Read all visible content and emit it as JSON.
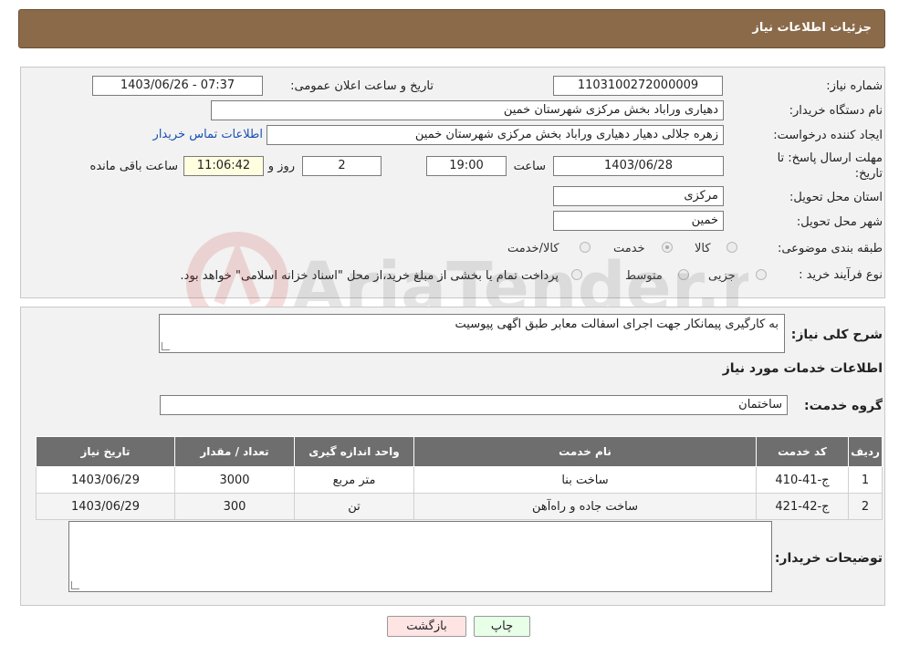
{
  "header": {
    "title": "جزئیات اطلاعات نیاز"
  },
  "labels": {
    "need_number": "شماره نیاز:",
    "announce_datetime": "تاریخ و ساعت اعلان عمومی:",
    "buyer_org": "نام دستگاه خریدار:",
    "requester": "ایجاد کننده درخواست:",
    "deadline_line1": "مهلت ارسال پاسخ: تا",
    "deadline_line2": "تاریخ:",
    "time_word": "ساعت",
    "day_word": "روز و",
    "remaining_word": "ساعت باقی مانده",
    "province": "استان محل تحویل:",
    "city": "شهر محل تحویل:",
    "category": "طبقه بندی موضوعی:",
    "process_type": "نوع فرآیند خرید :",
    "description": "شرح کلی نیاز:",
    "services_info": "اطلاعات خدمات مورد نیاز",
    "service_group": "گروه خدمت:",
    "buyer_notes": "توضیحات خریدار:"
  },
  "values": {
    "need_number": "1103100272000009",
    "announce_datetime": "1403/06/26 - 07:37",
    "buyer_org": "دهیاری وراباد بخش مرکزی شهرستان خمین",
    "requester": "زهره جلالی دهیار  دهیاری وراباد بخش مرکزی شهرستان خمین",
    "contact_link": "اطلاعات تماس خریدار",
    "deadline_date": "1403/06/28",
    "deadline_time": "19:00",
    "days_remaining": "2",
    "time_remaining": "11:06:42",
    "province": "مرکزی",
    "city": "خمین",
    "service_group": "ساختمان",
    "description": "به کارگیری پیمانکار جهت اجرای اسفالت معابر طبق اگهی پیوسیت",
    "buyer_notes": ""
  },
  "category_options": [
    {
      "label": "کالا",
      "checked": false
    },
    {
      "label": "خدمت",
      "checked": true
    },
    {
      "label": "کالا/خدمت",
      "checked": false
    }
  ],
  "process_options": [
    {
      "label": "جزیی",
      "checked": false
    },
    {
      "label": "متوسط",
      "checked": false
    }
  ],
  "process_note": "پرداخت تمام یا بخشی از مبلغ خرید،از محل \"اسناد خزانه اسلامی\" خواهد بود.",
  "table": {
    "headers": [
      "ردیف",
      "کد خدمت",
      "نام خدمت",
      "واحد اندازه گیری",
      "تعداد / مقدار",
      "تاریخ نیاز"
    ],
    "rows": [
      [
        "1",
        "ج-41-410",
        "ساخت بنا",
        "متر مربع",
        "3000",
        "1403/06/29"
      ],
      [
        "2",
        "ج-42-421",
        "ساخت جاده و راه‌آهن",
        "تن",
        "300",
        "1403/06/29"
      ]
    ]
  },
  "buttons": {
    "print": "چاپ",
    "back": "بازگشت"
  },
  "colors": {
    "header_bg": "#8b6a4a",
    "table_header_bg": "#6e6e6e",
    "back_button_bg": "#ffe4e4",
    "print_button_bg": "#e8ffe8"
  },
  "watermark_text": "AriaTender.neT"
}
